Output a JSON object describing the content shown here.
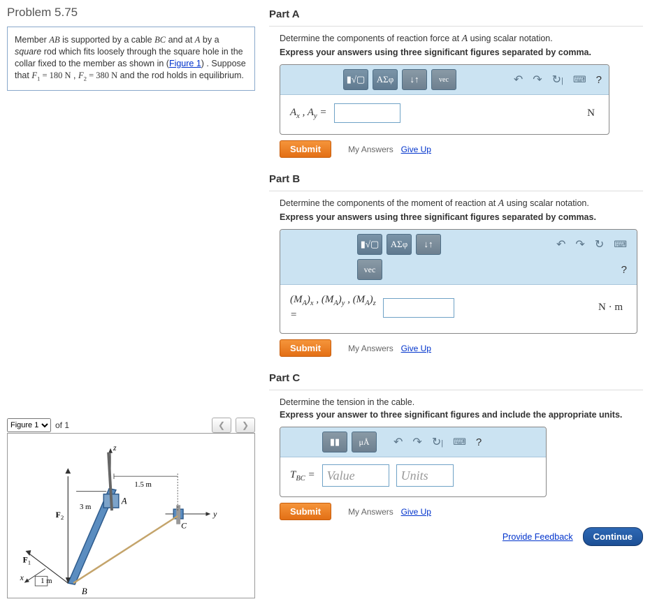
{
  "problem": {
    "number": "Problem 5.75",
    "text_pre": "Member ",
    "ab": "AB",
    "text_mid1": " is supported by a cable ",
    "bc": "BC",
    "text_mid2": " and at ",
    "a": "A",
    "text_mid3": " by a ",
    "square": "square",
    "text_mid4": " rod which fits loosely through the square hole in the collar fixed to the member as shown in (",
    "fig_link": "Figure 1",
    "text_mid5": ") . Suppose that ",
    "f1_name": "F",
    "f1_sub": "1",
    "f1_eq": " = 180  N",
    "comma": " , ",
    "f2_name": "F",
    "f2_sub": "2",
    "f2_eq": " = 380  N",
    "text_end": " and the rod holds in equilibrium."
  },
  "figure": {
    "select": "Figure 1",
    "of": "of 1",
    "prev": "❮",
    "next": "❯"
  },
  "partA": {
    "title": "Part A",
    "instr": "Determine the components of reaction force at ",
    "instr_var": "A",
    "instr_end": " using scalar notation.",
    "express": "Express your answers using three significant figures separated by comma.",
    "label_html": "A<sub>x</sub> , A<sub>y</sub>  =",
    "unit": "N"
  },
  "partB": {
    "title": "Part B",
    "instr": "Determine the components of the moment of reaction at ",
    "instr_var": "A",
    "instr_end": " using scalar notation.",
    "express": "Express your answers using three significant figures separated by commas.",
    "label_html": "(M<sub>A</sub>)<sub>x</sub> , (M<sub>A</sub>)<sub>y</sub> , (M<sub>A</sub>)<sub>z</sub><br>=",
    "unit": "N · m"
  },
  "partC": {
    "title": "Part C",
    "instr": "Determine the tension in the cable.",
    "express": "Express your answer to three significant figures and include the appropriate units.",
    "label_html": "T<sub>BC</sub>  =",
    "value_ph": "Value",
    "units_ph": "Units"
  },
  "toolbar": {
    "templates": "▮√▢",
    "greek": "ΑΣφ",
    "arrows": "↓↑",
    "vec": "vec",
    "undo": "↶",
    "redo": "↷",
    "reset": "↻",
    "reset_bar": "|",
    "keyboard": "⌨",
    "help": "?",
    "units_tool": "▮▮",
    "mu": "μÅ"
  },
  "actions": {
    "submit": "Submit",
    "my_answers": "My Answers",
    "give_up": "Give Up"
  },
  "footer": {
    "feedback": "Provide Feedback",
    "continue": "Continue"
  }
}
